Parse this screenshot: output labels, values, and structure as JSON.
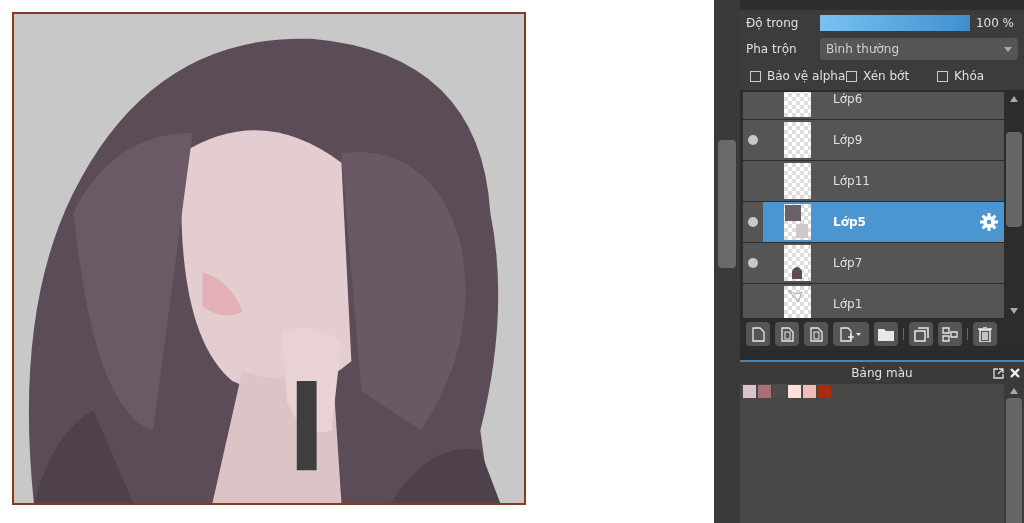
{
  "layer_panel": {
    "opacity": {
      "label": "Độ trong",
      "level": 1,
      "reading": "100 %"
    },
    "blend": {
      "label": "Pha trộn",
      "value": "Bình thường"
    },
    "options": [
      {
        "label": "Bảo vệ alpha",
        "checked": false
      },
      {
        "label": "Xén bớt",
        "checked": false
      },
      {
        "label": "Khóa",
        "checked": false
      }
    ],
    "layers": [
      {
        "name": "Lớp6",
        "visible": false,
        "selected": false
      },
      {
        "name": "Lớp9",
        "visible": true,
        "selected": false
      },
      {
        "name": "Lớp11",
        "visible": false,
        "selected": false
      },
      {
        "name": "Lớp5",
        "visible": true,
        "selected": true
      },
      {
        "name": "Lớp7",
        "visible": true,
        "selected": false
      },
      {
        "name": "Lớp1",
        "visible": false,
        "selected": false
      }
    ]
  },
  "palette_panel": {
    "title": "Bảng màu",
    "swatches": [
      {
        "color": "#dcc5ca"
      },
      {
        "color": "#a87079"
      },
      {
        "color": "#4c4c4c"
      },
      {
        "color": "#fde0d9"
      },
      {
        "color": "#f0bcb9"
      },
      {
        "color": "#a82b10"
      }
    ]
  }
}
